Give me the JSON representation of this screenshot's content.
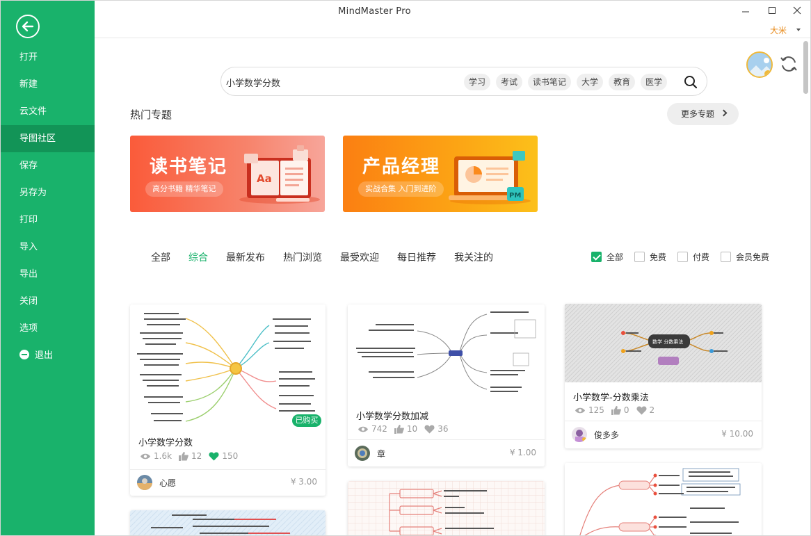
{
  "window": {
    "title": "MindMaster Pro"
  },
  "user": {
    "name": "大米"
  },
  "sidebar": {
    "items": [
      {
        "label": "打开"
      },
      {
        "label": "新建"
      },
      {
        "label": "云文件"
      },
      {
        "label": "导图社区",
        "active": true
      },
      {
        "label": "保存"
      },
      {
        "label": "另存为"
      },
      {
        "label": "打印"
      },
      {
        "label": "导入"
      },
      {
        "label": "导出"
      },
      {
        "label": "关闭"
      },
      {
        "label": "选项"
      },
      {
        "label": "退出"
      }
    ]
  },
  "search": {
    "value": "小学数学分数",
    "tags": [
      "学习",
      "考试",
      "读书笔记",
      "大学",
      "教育",
      "医学"
    ]
  },
  "hot": {
    "title": "热门专题",
    "more_label": "更多专题",
    "banners": [
      {
        "title": "读书笔记",
        "subtitle": "高分书籍 精华笔记",
        "art_text": "Aa"
      },
      {
        "title": "产品经理",
        "subtitle": "实战合集 入门到进阶",
        "art_text": "PM"
      }
    ]
  },
  "tabs": [
    "全部",
    "综合",
    "最新发布",
    "热门浏览",
    "最受欢迎",
    "每日推荐",
    "我关注的"
  ],
  "active_tab": "综合",
  "filters": [
    {
      "label": "全部",
      "checked": true
    },
    {
      "label": "免费",
      "checked": false
    },
    {
      "label": "付费",
      "checked": false
    },
    {
      "label": "会员免费",
      "checked": false
    }
  ],
  "cards": [
    {
      "title": "小学数学分数",
      "views": "1.6k",
      "likes": "12",
      "favorites": "150",
      "author": "心愿",
      "price": "¥ 3.00",
      "badge": "已购买"
    },
    {
      "title": "小学数学分数加减",
      "views": "742",
      "likes": "10",
      "favorites": "36",
      "author": "章",
      "price": "¥ 1.00"
    },
    {
      "title": "小学数学-分数乘法",
      "views": "125",
      "likes": "0",
      "favorites": "2",
      "author": "俊多多",
      "price": "¥ 10.00",
      "map_center": "数学 分数乘法"
    }
  ],
  "colors": {
    "accent": "#19b26b",
    "sidebar_active": "#129457",
    "user_name": "#e88a1a"
  }
}
